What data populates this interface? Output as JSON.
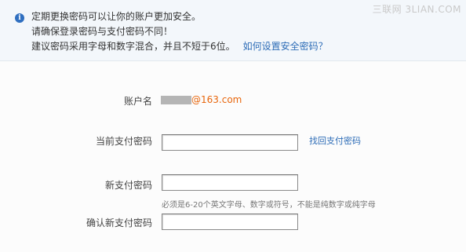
{
  "notice": {
    "icon": "info-icon",
    "line1": "定期更换密码可以让你的账户更加安全。",
    "line2": "请确保登录密码与支付密码不同！",
    "line3": "建议密码采用字母和数字混合，并且不短于6位。",
    "help_link": "如何设置安全密码？"
  },
  "watermark": "三联网 3LIAN.COM",
  "form": {
    "account": {
      "label": "账户名",
      "domain": "@163.com"
    },
    "current_password": {
      "label": "当前支付密码",
      "value": "",
      "forgot_link": "找回支付密码"
    },
    "new_password": {
      "label": "新支付密码",
      "value": "",
      "hint": "必须是6-20个英文字母、数字或符号，不能是纯数字或纯字母"
    },
    "confirm_password": {
      "label": "确认新支付密码",
      "value": ""
    }
  },
  "colors": {
    "link": "#2e6db7",
    "domain": "#e8660c",
    "notice_bg": "#f3f7fb",
    "info_icon": "#2f6fc0"
  }
}
